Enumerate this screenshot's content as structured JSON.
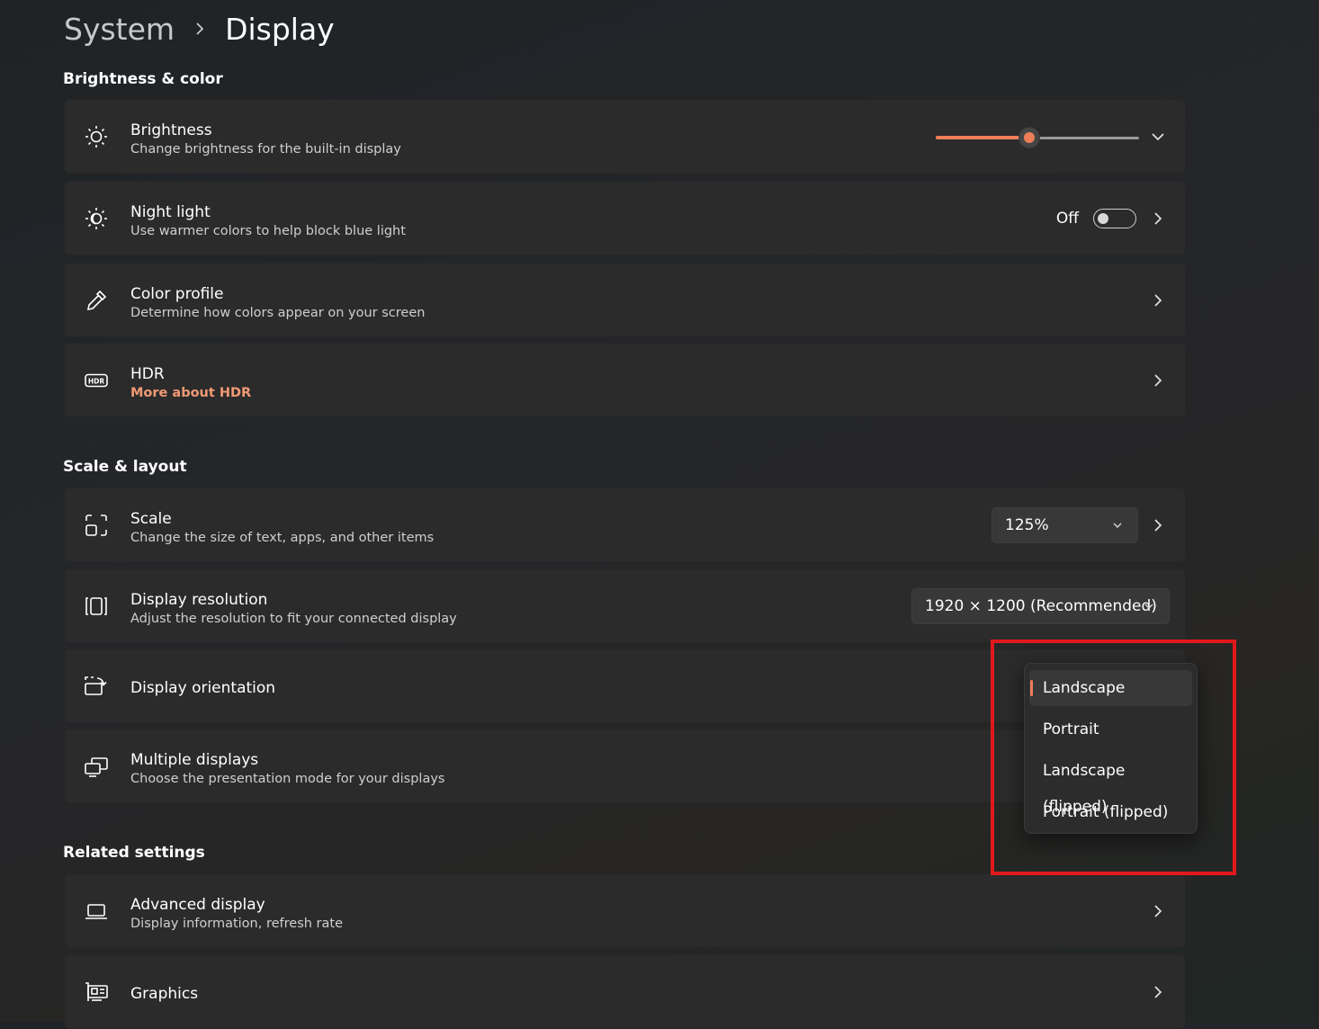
{
  "breadcrumb": {
    "parent": "System",
    "current": "Display"
  },
  "sections": {
    "brightness_color": "Brightness & color",
    "scale_layout": "Scale & layout",
    "related": "Related settings"
  },
  "brightness": {
    "title": "Brightness",
    "subtitle": "Change brightness for the built-in display",
    "level": 0.46,
    "icon": "sun-icon"
  },
  "night_light": {
    "title": "Night light",
    "subtitle": "Use warmer colors to help block blue light",
    "state": "Off",
    "icon": "night-light-icon"
  },
  "color_profile": {
    "title": "Color profile",
    "subtitle": "Determine how colors appear on your screen",
    "icon": "eyedropper-icon"
  },
  "hdr": {
    "title": "HDR",
    "link": "More about HDR",
    "icon": "hdr-icon"
  },
  "scale": {
    "title": "Scale",
    "subtitle": "Change the size of text, apps, and other items",
    "value": "125%",
    "icon": "scale-icon"
  },
  "resolution": {
    "title": "Display resolution",
    "subtitle": "Adjust the resolution to fit your connected display",
    "value": "1920 × 1200 (Recommended)",
    "icon": "resolution-icon"
  },
  "orientation": {
    "title": "Display orientation",
    "icon": "orientation-icon",
    "options": [
      "Landscape",
      "Portrait",
      "Landscape (flipped)",
      "Portrait (flipped)"
    ],
    "selected": "Landscape"
  },
  "multiple": {
    "title": "Multiple displays",
    "subtitle": "Choose the presentation mode for your displays",
    "icon": "multiple-displays-icon"
  },
  "advanced": {
    "title": "Advanced display",
    "subtitle": "Display information, refresh rate",
    "icon": "laptop-icon"
  },
  "graphics": {
    "title": "Graphics",
    "icon": "graphics-card-icon"
  },
  "colors": {
    "accent": "#ee7e58",
    "link": "#f09a74",
    "highlight": "#e1191b"
  }
}
